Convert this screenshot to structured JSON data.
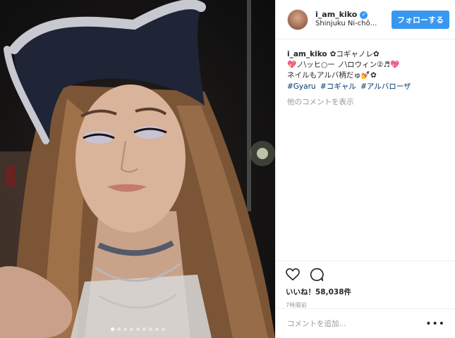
{
  "post": {
    "username": "i_am_kiko",
    "verified_icon": "verified-check-icon",
    "location": "Shinjuku Ni-chō...",
    "follow_label": "フォローする",
    "caption": {
      "line1": "✿コギャノレ✿",
      "line2": "💖ノ\\ッヒ○ー ノ\\ロウィン②♬💖",
      "line3": "ネイルもアルバ柄だゅ💅✿",
      "hashtags": [
        "#Gyaru",
        "#コギャル",
        "#アルバローザ"
      ]
    },
    "more_comments": "他のコメントを表示",
    "likes": "いいね！58,038件",
    "timestamp": "7時間前",
    "comment_placeholder": "コメントを追加...",
    "more_icon": "more-dots-icon",
    "carousel": {
      "count": 9,
      "active_index": 0
    }
  },
  "colors": {
    "accent": "#3897f0",
    "hashtag": "#003569",
    "muted": "#999999"
  }
}
